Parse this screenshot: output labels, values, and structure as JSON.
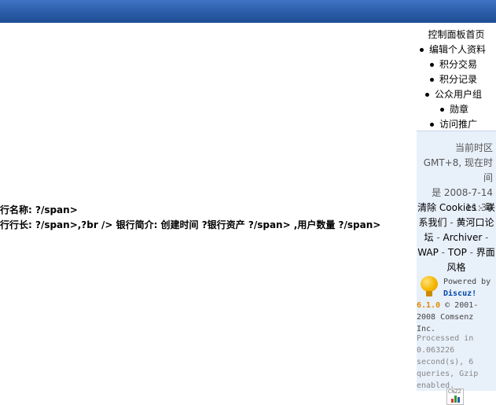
{
  "main": {
    "line1": "行名称: ?/span>",
    "line2": "行行长: ?/span>,?br /> 银行简介: 创建时间 ?银行资产 ?/span> ,用户数量 ?/span>"
  },
  "sidebar": {
    "menu_title": "控制面板首页",
    "items": [
      {
        "label": "编辑个人资料"
      },
      {
        "label": "积分交易"
      },
      {
        "label": "积分记录"
      },
      {
        "label": "公众用户组"
      },
      {
        "label": "勋章"
      },
      {
        "label": "访问推广"
      }
    ]
  },
  "footer": {
    "timezone_lines": [
      "当前时区",
      "GMT+8, 现在时间",
      "是 2008-7-14",
      "11:34"
    ],
    "links": {
      "clear_cookies": "清除 Cookies",
      "contact": "联系我们",
      "forum": "黄河口论坛",
      "archiver": "Archiver",
      "wap": "WAP",
      "top": "TOP",
      "style": "界面风格",
      "separator": " - "
    },
    "powered_by": "Powered by",
    "discuz_name": "Discuz!",
    "discuz_version": "6.1.0",
    "copyright": "© 2001-2008 Comsenz Inc.",
    "processed": "Processed in 0.063226 second(s), 6 queries, Gzip enabled.",
    "cnzz_label": "CNZZ"
  },
  "colors": {
    "banner": "#2a5ca8",
    "footer_bg": "#e8f0fa",
    "discuz_blue": "#0046a6",
    "version_orange": "#e08a00"
  },
  "icons": {
    "bulb": "discuz-lightbulb-icon",
    "stats": "cnzz-stats-icon"
  }
}
